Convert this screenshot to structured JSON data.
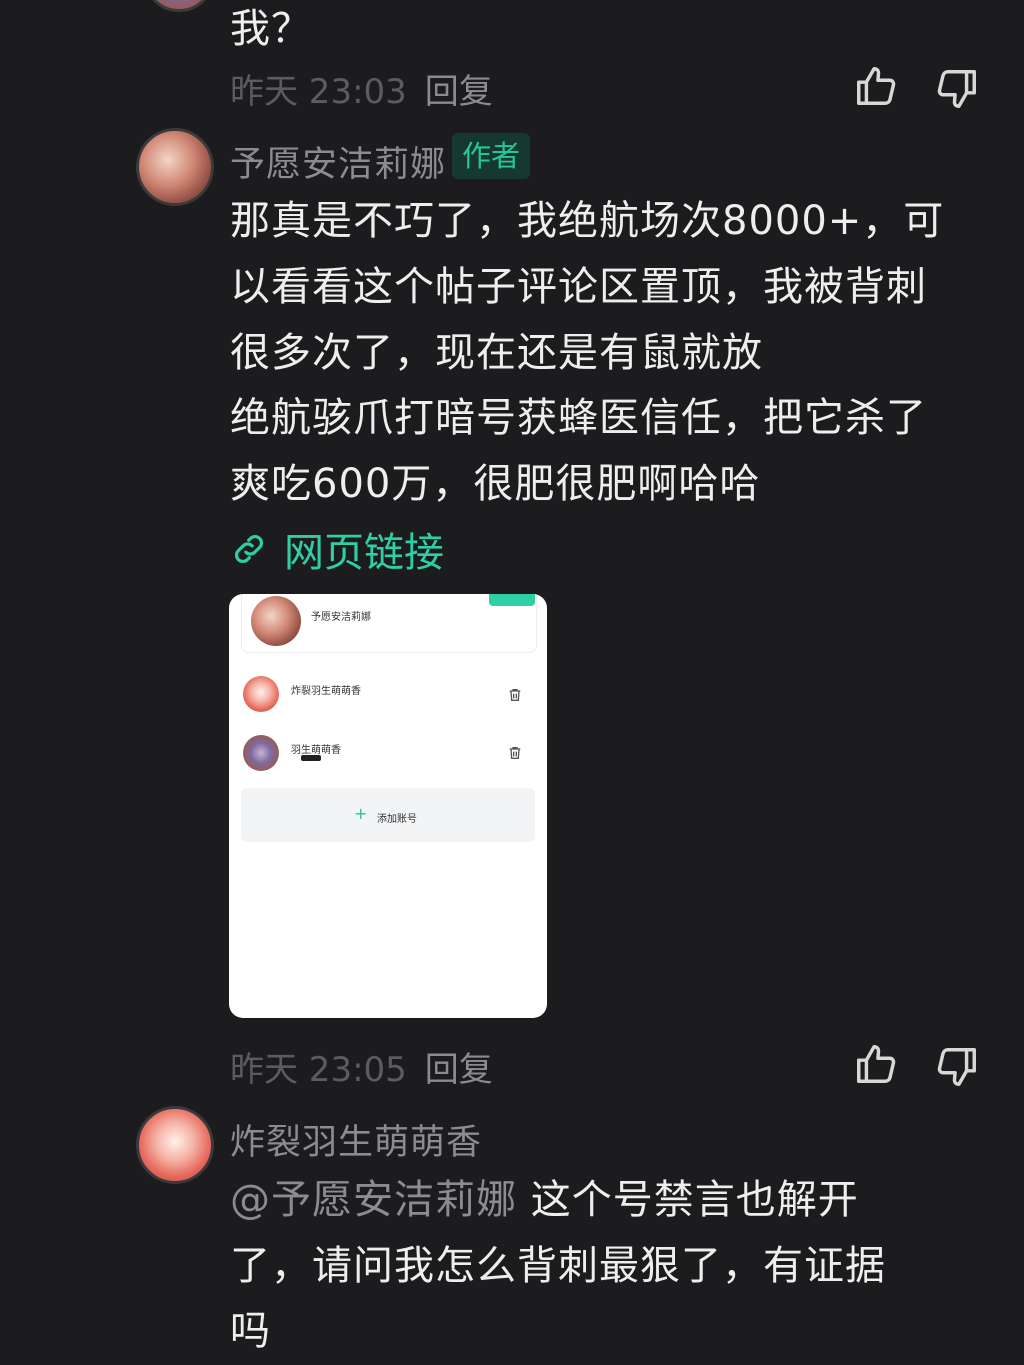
{
  "comment_top": {
    "text": "我？",
    "time": "昨天 23:03",
    "reply_label": "回复"
  },
  "comment_author": {
    "username": "予愿安洁莉娜",
    "badge": "作者",
    "lines": [
      "那真是不巧了，我绝航场次8000+，可",
      "以看看这个帖子评论区置顶，我被背刺",
      "很多次了，现在还是有鼠就放",
      "绝航骇爪打暗号获蜂医信任，把它杀了",
      "爽吃600万，很肥很肥啊哈哈"
    ],
    "link_label": "网页链接",
    "time": "昨天 23:05",
    "reply_label": "回复",
    "screenshot": {
      "account_name": "予愿安洁莉娜",
      "accounts": [
        "炸裂羽生萌萌香",
        "羽生萌萌香"
      ],
      "add_label": "添加账号",
      "add_icon": "plus-icon",
      "trash_icon": "trash-icon",
      "tag_color": "#2fd0a5"
    }
  },
  "comment_reply": {
    "username": "炸裂羽生萌萌香",
    "mention": "@予愿安洁莉娜",
    "line1_rest": "这个号禁言也解开",
    "line2": "了，请问我怎么背刺最狠了，有证据",
    "line3": "吗"
  },
  "icons": {
    "like": "thumbs-up-icon",
    "dislike": "thumbs-down-icon",
    "link": "link-icon"
  },
  "colors": {
    "background": "#1c1c1e",
    "accent": "#2fcfa6",
    "badge_bg": "#16392f",
    "muted": "#8b8b90"
  }
}
